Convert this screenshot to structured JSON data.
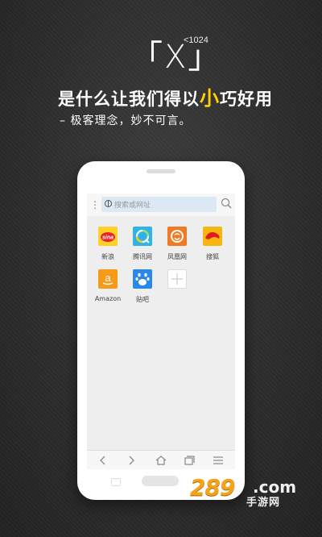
{
  "hero": {
    "logo_bracket_open": "「",
    "logo_x": "X",
    "logo_bracket_close": "」",
    "logo_sup": "<1024",
    "headline_pre": "是什么让我们得以",
    "headline_highlight": "小",
    "headline_post": "巧好用",
    "subline": "– 极客理念，妙不可言。",
    "highlight_color": "#ffd200"
  },
  "browser": {
    "search_placeholder": "搜索或网址",
    "menu_icon": "⋮",
    "shortcuts": [
      {
        "label": "新浪",
        "icon": "sina-icon",
        "color": "#ffd028"
      },
      {
        "label": "腾讯网",
        "icon": "tencent-icon",
        "color": "#2fb3e8"
      },
      {
        "label": "凤凰网",
        "icon": "ifeng-icon",
        "color": "#f07a24"
      },
      {
        "label": "搜狐",
        "icon": "sohu-icon",
        "color": "#f6b512"
      },
      {
        "label": "Amazon",
        "icon": "amazon-icon",
        "color": "#f69a1a"
      },
      {
        "label": "贴吧",
        "icon": "tieba-icon",
        "color": "#2b87e8"
      },
      {
        "label": "",
        "icon": "add-icon",
        "color": "#ffffff"
      }
    ],
    "sina_text": "sina",
    "amazon_letter": "a"
  },
  "watermark": {
    "number": "289",
    "domain": ".com",
    "chinese": "手游网"
  }
}
